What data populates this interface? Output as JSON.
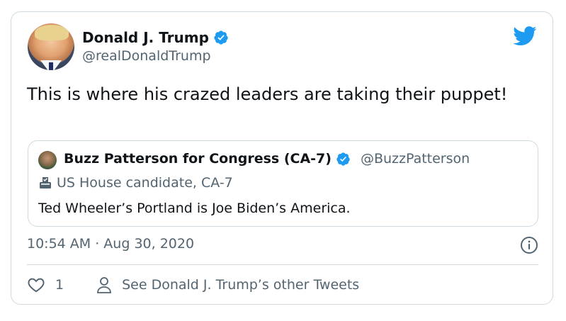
{
  "author": {
    "name": "Donald J. Trump",
    "handle": "@realDonaldTrump"
  },
  "tweet": {
    "text": "This is where his crazed leaders are taking their puppet!",
    "timestamp": "10:54 AM · Aug 30, 2020"
  },
  "quoted_tweet": {
    "name": "Buzz Patterson for Congress (CA-7)",
    "handle": "@BuzzPatterson",
    "label": "US House candidate, CA-7",
    "text": "Ted Wheeler’s Portland is Joe Biden’s America."
  },
  "actions": {
    "like_count": "1",
    "other_tweets_label": "See Donald J. Trump’s other Tweets"
  },
  "icons": {
    "verified": "verified-badge-icon",
    "bird": "twitter-bird-icon",
    "ballot": "ballot-box-icon",
    "info": "info-icon",
    "like": "heart-icon",
    "person": "person-icon"
  },
  "colors": {
    "brand": "#1d9bf0",
    "secondary_text": "#536471",
    "border": "#cfd9de"
  }
}
